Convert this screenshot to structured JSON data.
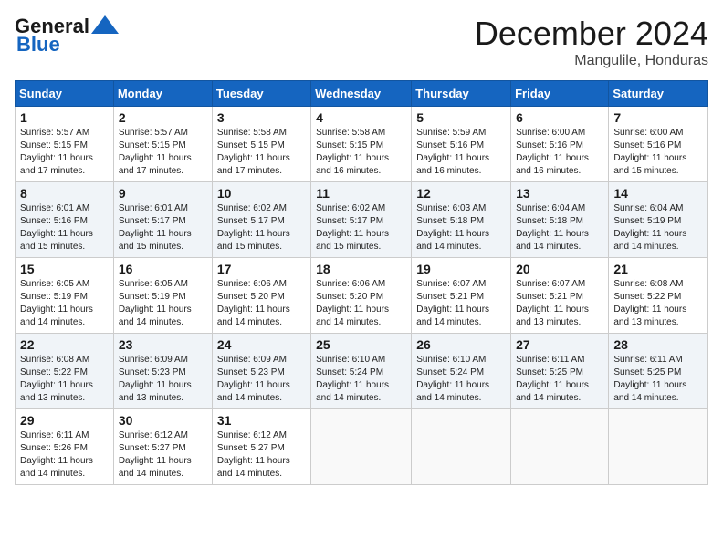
{
  "header": {
    "logo_line1": "General",
    "logo_line2": "Blue",
    "month": "December 2024",
    "location": "Mangulile, Honduras"
  },
  "days_of_week": [
    "Sunday",
    "Monday",
    "Tuesday",
    "Wednesday",
    "Thursday",
    "Friday",
    "Saturday"
  ],
  "weeks": [
    [
      {
        "day": "1",
        "info": "Sunrise: 5:57 AM\nSunset: 5:15 PM\nDaylight: 11 hours and 17 minutes."
      },
      {
        "day": "2",
        "info": "Sunrise: 5:57 AM\nSunset: 5:15 PM\nDaylight: 11 hours and 17 minutes."
      },
      {
        "day": "3",
        "info": "Sunrise: 5:58 AM\nSunset: 5:15 PM\nDaylight: 11 hours and 17 minutes."
      },
      {
        "day": "4",
        "info": "Sunrise: 5:58 AM\nSunset: 5:15 PM\nDaylight: 11 hours and 16 minutes."
      },
      {
        "day": "5",
        "info": "Sunrise: 5:59 AM\nSunset: 5:16 PM\nDaylight: 11 hours and 16 minutes."
      },
      {
        "day": "6",
        "info": "Sunrise: 6:00 AM\nSunset: 5:16 PM\nDaylight: 11 hours and 16 minutes."
      },
      {
        "day": "7",
        "info": "Sunrise: 6:00 AM\nSunset: 5:16 PM\nDaylight: 11 hours and 15 minutes."
      }
    ],
    [
      {
        "day": "8",
        "info": "Sunrise: 6:01 AM\nSunset: 5:16 PM\nDaylight: 11 hours and 15 minutes."
      },
      {
        "day": "9",
        "info": "Sunrise: 6:01 AM\nSunset: 5:17 PM\nDaylight: 11 hours and 15 minutes."
      },
      {
        "day": "10",
        "info": "Sunrise: 6:02 AM\nSunset: 5:17 PM\nDaylight: 11 hours and 15 minutes."
      },
      {
        "day": "11",
        "info": "Sunrise: 6:02 AM\nSunset: 5:17 PM\nDaylight: 11 hours and 15 minutes."
      },
      {
        "day": "12",
        "info": "Sunrise: 6:03 AM\nSunset: 5:18 PM\nDaylight: 11 hours and 14 minutes."
      },
      {
        "day": "13",
        "info": "Sunrise: 6:04 AM\nSunset: 5:18 PM\nDaylight: 11 hours and 14 minutes."
      },
      {
        "day": "14",
        "info": "Sunrise: 6:04 AM\nSunset: 5:19 PM\nDaylight: 11 hours and 14 minutes."
      }
    ],
    [
      {
        "day": "15",
        "info": "Sunrise: 6:05 AM\nSunset: 5:19 PM\nDaylight: 11 hours and 14 minutes."
      },
      {
        "day": "16",
        "info": "Sunrise: 6:05 AM\nSunset: 5:19 PM\nDaylight: 11 hours and 14 minutes."
      },
      {
        "day": "17",
        "info": "Sunrise: 6:06 AM\nSunset: 5:20 PM\nDaylight: 11 hours and 14 minutes."
      },
      {
        "day": "18",
        "info": "Sunrise: 6:06 AM\nSunset: 5:20 PM\nDaylight: 11 hours and 14 minutes."
      },
      {
        "day": "19",
        "info": "Sunrise: 6:07 AM\nSunset: 5:21 PM\nDaylight: 11 hours and 14 minutes."
      },
      {
        "day": "20",
        "info": "Sunrise: 6:07 AM\nSunset: 5:21 PM\nDaylight: 11 hours and 13 minutes."
      },
      {
        "day": "21",
        "info": "Sunrise: 6:08 AM\nSunset: 5:22 PM\nDaylight: 11 hours and 13 minutes."
      }
    ],
    [
      {
        "day": "22",
        "info": "Sunrise: 6:08 AM\nSunset: 5:22 PM\nDaylight: 11 hours and 13 minutes."
      },
      {
        "day": "23",
        "info": "Sunrise: 6:09 AM\nSunset: 5:23 PM\nDaylight: 11 hours and 13 minutes."
      },
      {
        "day": "24",
        "info": "Sunrise: 6:09 AM\nSunset: 5:23 PM\nDaylight: 11 hours and 14 minutes."
      },
      {
        "day": "25",
        "info": "Sunrise: 6:10 AM\nSunset: 5:24 PM\nDaylight: 11 hours and 14 minutes."
      },
      {
        "day": "26",
        "info": "Sunrise: 6:10 AM\nSunset: 5:24 PM\nDaylight: 11 hours and 14 minutes."
      },
      {
        "day": "27",
        "info": "Sunrise: 6:11 AM\nSunset: 5:25 PM\nDaylight: 11 hours and 14 minutes."
      },
      {
        "day": "28",
        "info": "Sunrise: 6:11 AM\nSunset: 5:25 PM\nDaylight: 11 hours and 14 minutes."
      }
    ],
    [
      {
        "day": "29",
        "info": "Sunrise: 6:11 AM\nSunset: 5:26 PM\nDaylight: 11 hours and 14 minutes."
      },
      {
        "day": "30",
        "info": "Sunrise: 6:12 AM\nSunset: 5:27 PM\nDaylight: 11 hours and 14 minutes."
      },
      {
        "day": "31",
        "info": "Sunrise: 6:12 AM\nSunset: 5:27 PM\nDaylight: 11 hours and 14 minutes."
      },
      null,
      null,
      null,
      null
    ]
  ]
}
